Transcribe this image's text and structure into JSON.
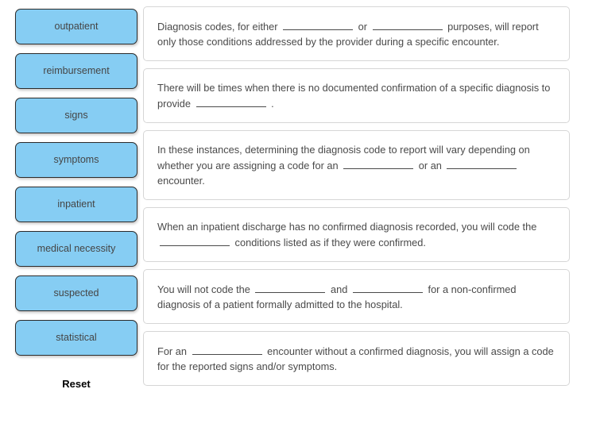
{
  "exercise": {
    "name": "fill-in-the-blank-drag-drop",
    "colors": {
      "tile_fill": "#86cdf3",
      "tile_border": "#2b2b2b",
      "tile_text": "#454545",
      "panel_border": "#d6d6d6",
      "panel_text": "#4a4a4a",
      "page_background": "#ffffff"
    }
  },
  "word_bank": {
    "label": "word-bank",
    "tiles": [
      {
        "label": "outpatient"
      },
      {
        "label": "reimbursement"
      },
      {
        "label": "signs"
      },
      {
        "label": "symptoms"
      },
      {
        "label": "inpatient"
      },
      {
        "label": "medical necessity"
      },
      {
        "label": "suspected"
      },
      {
        "label": "statistical"
      }
    ],
    "reset_label": "Reset"
  },
  "panels": [
    {
      "id": "panel-1",
      "segments": [
        {
          "type": "text",
          "value": "Diagnosis codes, for either "
        },
        {
          "type": "blank"
        },
        {
          "type": "text",
          "value": " or "
        },
        {
          "type": "blank"
        },
        {
          "type": "text",
          "value": " purposes, will report only those conditions addressed by the provider during a specific encounter."
        }
      ]
    },
    {
      "id": "panel-2",
      "segments": [
        {
          "type": "text",
          "value": "There will be times when there is no documented confirmation of a specific diagnosis to provide "
        },
        {
          "type": "blank"
        },
        {
          "type": "text",
          "value": " ."
        }
      ]
    },
    {
      "id": "panel-3",
      "segments": [
        {
          "type": "text",
          "value": "In these instances, determining the diagnosis code to report will vary depending on whether you are assigning a code for an "
        },
        {
          "type": "blank"
        },
        {
          "type": "text",
          "value": " or an "
        },
        {
          "type": "blank"
        },
        {
          "type": "text",
          "value": " encounter."
        }
      ]
    },
    {
      "id": "panel-4",
      "segments": [
        {
          "type": "text",
          "value": "When an inpatient discharge has no confirmed diagnosis recorded, you will code the "
        },
        {
          "type": "blank"
        },
        {
          "type": "text",
          "value": " conditions listed as if they were confirmed."
        }
      ]
    },
    {
      "id": "panel-5",
      "segments": [
        {
          "type": "text",
          "value": "You will not code the "
        },
        {
          "type": "blank"
        },
        {
          "type": "text",
          "value": " and "
        },
        {
          "type": "blank"
        },
        {
          "type": "text",
          "value": " for a non-confirmed diagnosis of a patient formally admitted to the hospital."
        }
      ]
    },
    {
      "id": "panel-6",
      "segments": [
        {
          "type": "text",
          "value": "For an "
        },
        {
          "type": "blank"
        },
        {
          "type": "text",
          "value": " encounter without a confirmed diagnosis, you will assign a code for the reported signs and/or symptoms."
        }
      ]
    }
  ]
}
